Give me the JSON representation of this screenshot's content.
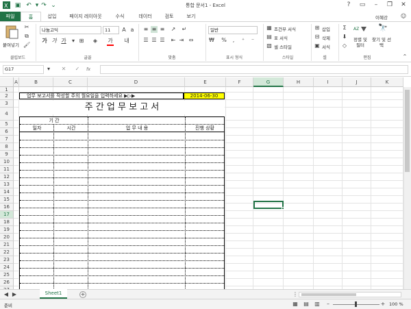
{
  "window": {
    "title": "통합 문서1 - Excel",
    "user": "이혜강"
  },
  "tabs": [
    "파일",
    "홈",
    "삽입",
    "페이지 레이아웃",
    "수식",
    "데이터",
    "검토",
    "보기"
  ],
  "ribbon": {
    "clipboard": {
      "paste": "붙여넣기",
      "label": "클립보드"
    },
    "font": {
      "name": "나눔고딕",
      "size": "11",
      "label": "글꼴"
    },
    "alignment": {
      "label": "맞춤"
    },
    "number": {
      "format": "일반",
      "label": "표시 형식"
    },
    "styles": {
      "conditional": "조건부 서식",
      "table": "표 서식",
      "cell": "셀 스타일",
      "label": "스타일"
    },
    "cells": {
      "insert": "삽입",
      "delete": "삭제",
      "format": "서식",
      "label": "셀"
    },
    "editing": {
      "sort": "정렬 및 필터",
      "find": "찾기 및 선택",
      "label": "편집"
    }
  },
  "formula_bar": {
    "name_box": "G17",
    "fx": "fx",
    "value": ""
  },
  "columns": [
    "A",
    "B",
    "C",
    "D",
    "E",
    "F",
    "G",
    "H",
    "I",
    "J",
    "K"
  ],
  "rows": [
    "1",
    "2",
    "3",
    "4",
    "5",
    "6",
    "7",
    "8",
    "9",
    "10",
    "11",
    "12",
    "13",
    "14",
    "15",
    "16",
    "17",
    "18",
    "19",
    "20",
    "21",
    "22",
    "23",
    "24",
    "25",
    "26",
    "27"
  ],
  "sheet": {
    "instruction": "업무 보고서를 작성할 주의 월요일을 입력하세요 ▶▷▶",
    "date": "2014-06-30",
    "title": "주 간 업 무 보 고 서",
    "period_label": "기     간",
    "col_date": "일자",
    "col_time": "시간",
    "col_content": "업  무   내  용",
    "col_status": "진행 상황"
  },
  "selected_cell": "G17",
  "sheet_tab": "Sheet1",
  "status": {
    "ready": "준비",
    "zoom": "100 %"
  },
  "colors": {
    "excel_green": "#217346",
    "date_fill": "#ffff00"
  }
}
